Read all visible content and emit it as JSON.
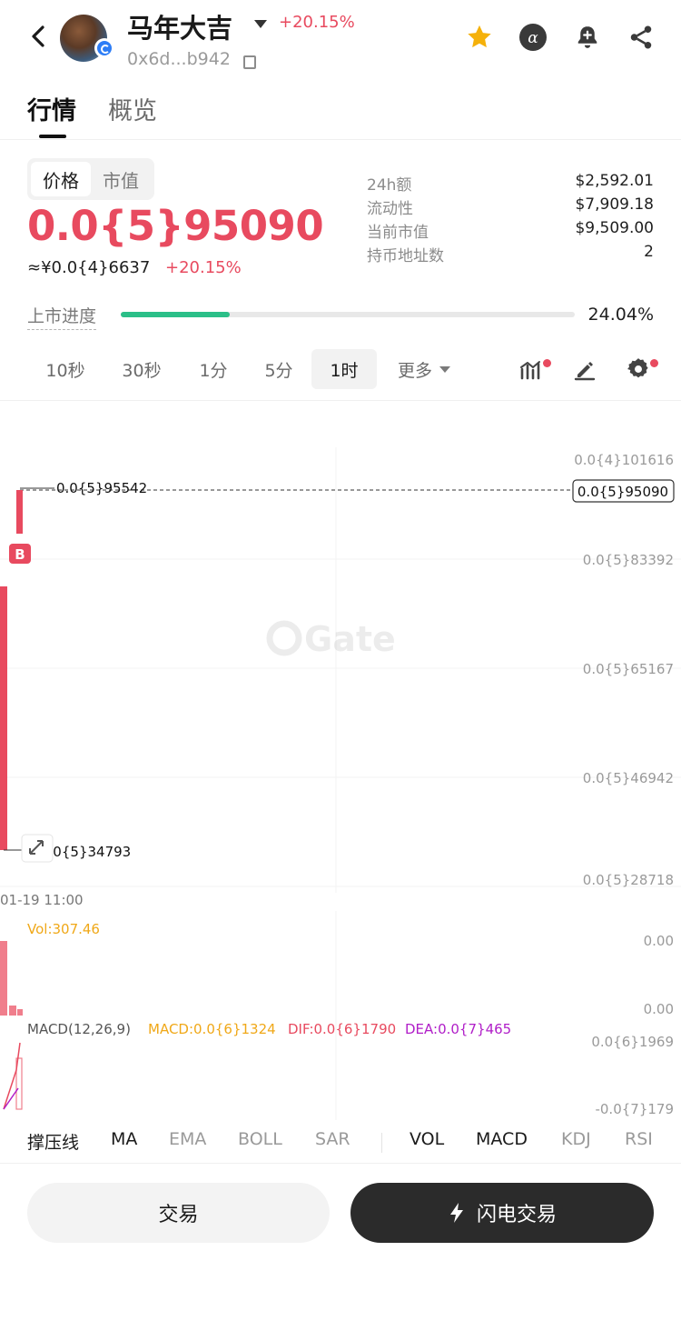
{
  "header": {
    "back_icon": "chevron-left-icon",
    "token_name": "马年大吉",
    "change": "+20.15%",
    "address": "0x6d...b942",
    "icons": [
      "star-icon",
      "alpha-icon",
      "bell-plus-icon",
      "share-icon"
    ],
    "colors": {
      "up": "#e84a5f",
      "star": "#f5b10a"
    }
  },
  "tabs": {
    "active": "行情",
    "inactive": "概览"
  },
  "price": {
    "seg_active": "价格",
    "seg_inactive": "市值",
    "big": "0.0{5}95090",
    "sub": "≈¥0.0{4}6637",
    "sub_change": "+20.15%"
  },
  "stats": [
    {
      "label": "24h额",
      "value": "$2,592.01"
    },
    {
      "label": "流动性",
      "value": "$7,909.18"
    },
    {
      "label": "当前市值",
      "value": "$9,509.00"
    },
    {
      "label": "持币地址数",
      "value": "2"
    }
  ],
  "progress": {
    "label": "上市进度",
    "value_text": "24.04%",
    "fraction": 0.2404,
    "color": "#2bbf88"
  },
  "intervals": {
    "items": [
      "10秒",
      "30秒",
      "1分",
      "5分",
      "1时"
    ],
    "active": "1时",
    "more": "更多"
  },
  "chart": {
    "watermark": "Gate",
    "y_labels": [
      "0.0{4}101616",
      "0.0{5}83392",
      "0.0{5}65167",
      "0.0{5}46942",
      "0.0{5}28718"
    ],
    "current_price": "0.0{5}95090",
    "high_label": "0.0{5}95542",
    "low_label": "0.0{5}34793",
    "buy_marker": "B",
    "time_label": "01-19 11:00",
    "vol_label": "Vol:307.46",
    "vol_axis": [
      "0.00",
      "0.00"
    ],
    "macd_params": "MACD(12,26,9)",
    "macd_value": "MACD:0.0{6}1324",
    "dif_value": "DIF:0.0{6}1790",
    "dea_value": "DEA:0.0{7}465",
    "macd_axis": [
      "0.0{6}1969",
      "-0.0{7}179"
    ]
  },
  "indicators": {
    "main": [
      {
        "label": "撑压线",
        "on": true
      },
      {
        "label": "MA",
        "on": true
      },
      {
        "label": "EMA",
        "on": false
      },
      {
        "label": "BOLL",
        "on": false
      },
      {
        "label": "SAR",
        "on": false
      }
    ],
    "sub": [
      {
        "label": "VOL",
        "on": true
      },
      {
        "label": "MACD",
        "on": true
      },
      {
        "label": "KDJ",
        "on": false
      },
      {
        "label": "RSI",
        "on": false
      }
    ]
  },
  "buttons": {
    "trade": "交易",
    "flash_trade": "闪电交易"
  }
}
